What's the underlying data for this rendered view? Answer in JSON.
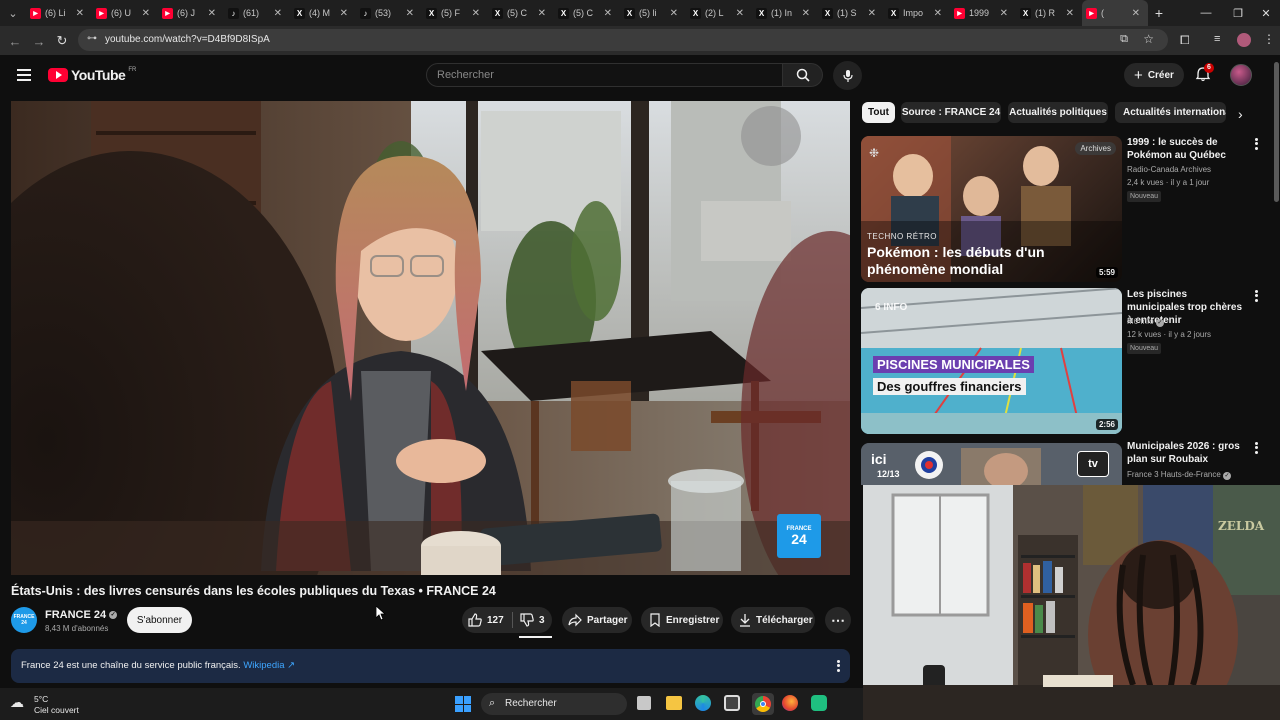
{
  "browser": {
    "tabs": [
      {
        "label": "(6) Li",
        "icon": "youtube-icon",
        "color": "#ff0033"
      },
      {
        "label": "(6) U",
        "icon": "youtube-icon",
        "color": "#ff0033"
      },
      {
        "label": "(6) J",
        "icon": "youtube-icon",
        "color": "#ff0033"
      },
      {
        "label": "(61)",
        "icon": "tiktok-icon",
        "color": "#111111"
      },
      {
        "label": "(4) M",
        "icon": "x-icon",
        "color": "#111111"
      },
      {
        "label": "(53)",
        "icon": "tiktok-icon",
        "color": "#111111"
      },
      {
        "label": "(5) F",
        "icon": "x-icon",
        "color": "#111111"
      },
      {
        "label": "(5) C",
        "icon": "x-icon",
        "color": "#111111"
      },
      {
        "label": "(5) C",
        "icon": "x-icon",
        "color": "#111111"
      },
      {
        "label": "(5) li",
        "icon": "x-icon",
        "color": "#111111"
      },
      {
        "label": "(2) L",
        "icon": "x-icon",
        "color": "#111111"
      },
      {
        "label": "(1) In",
        "icon": "x-icon",
        "color": "#111111"
      },
      {
        "label": "(1) S",
        "icon": "x-icon",
        "color": "#111111"
      },
      {
        "label": "Impo",
        "icon": "x-icon",
        "color": "#111111"
      },
      {
        "label": "1999",
        "icon": "youtube-icon",
        "color": "#ff0033"
      },
      {
        "label": "(1) R",
        "icon": "x-icon",
        "color": "#111111"
      },
      {
        "label": "(",
        "icon": "youtube-icon",
        "color": "#ff0033"
      }
    ],
    "url": "youtube.com/watch?v=D4Bf9D8ISpA"
  },
  "youtube": {
    "logo_text": "YouTube",
    "region": "FR",
    "search_placeholder": "Rechercher",
    "create_label": "Créer",
    "notif_count": "6"
  },
  "video": {
    "title": "États-Unis : des livres censurés dans les écoles publiques du Texas • FRANCE 24",
    "channel": "FRANCE 24",
    "subscribers": "8,43 M d'abonnés",
    "subscribe_label": "S'abonner",
    "likes": "127",
    "dislikes": "3",
    "share_label": "Partager",
    "save_label": "Enregistrer",
    "download_label": "Télécharger",
    "channel_logo_text": "FRANCE 24",
    "info_text": "France 24 est une chaîne du service public français.",
    "info_link": "Wikipedia ↗"
  },
  "chips": [
    "Tout",
    "Source : FRANCE 24",
    "Actualités politiques",
    "Actualités internationales"
  ],
  "recommendations": [
    {
      "title": "1999 : le succès de Pokémon au Québec",
      "channel": "Radio-Canada Archives",
      "meta": "2,4 k vues · il y a 1 jour",
      "badge": "Nouveau",
      "duration": "5:59",
      "thumb_tag": "Archives",
      "thumb_kicker": "TECHNO RÉTRO",
      "thumb_headline": "Pokémon : les débuts d'un phénomène mondial"
    },
    {
      "title": "Les piscines municipales trop chères à entretenir",
      "channel": "M6 Info",
      "meta": "12 k vues · il y a 2 jours",
      "badge": "Nouveau",
      "duration": "2:56",
      "thumb_brand": "6 INFO",
      "thumb_headline_1": "PISCINES MUNICIPALES",
      "thumb_headline_2": "Des gouffres financiers"
    },
    {
      "title": "Municipales 2026 : gros plan sur Roubaix",
      "channel": "France 3 Hauts-de-France",
      "thumb_brand": "ici",
      "thumb_sub": "12/13",
      "thumb_logo": "tv"
    }
  ],
  "taskbar": {
    "temperature": "5°C",
    "weather": "Ciel couvert",
    "search_label": "Rechercher"
  },
  "colors": {
    "yt_red": "#ff0033",
    "link_blue": "#3ea6ff",
    "desc_bg": "#1c2a44",
    "france24_blue": "#1e9ae8"
  }
}
